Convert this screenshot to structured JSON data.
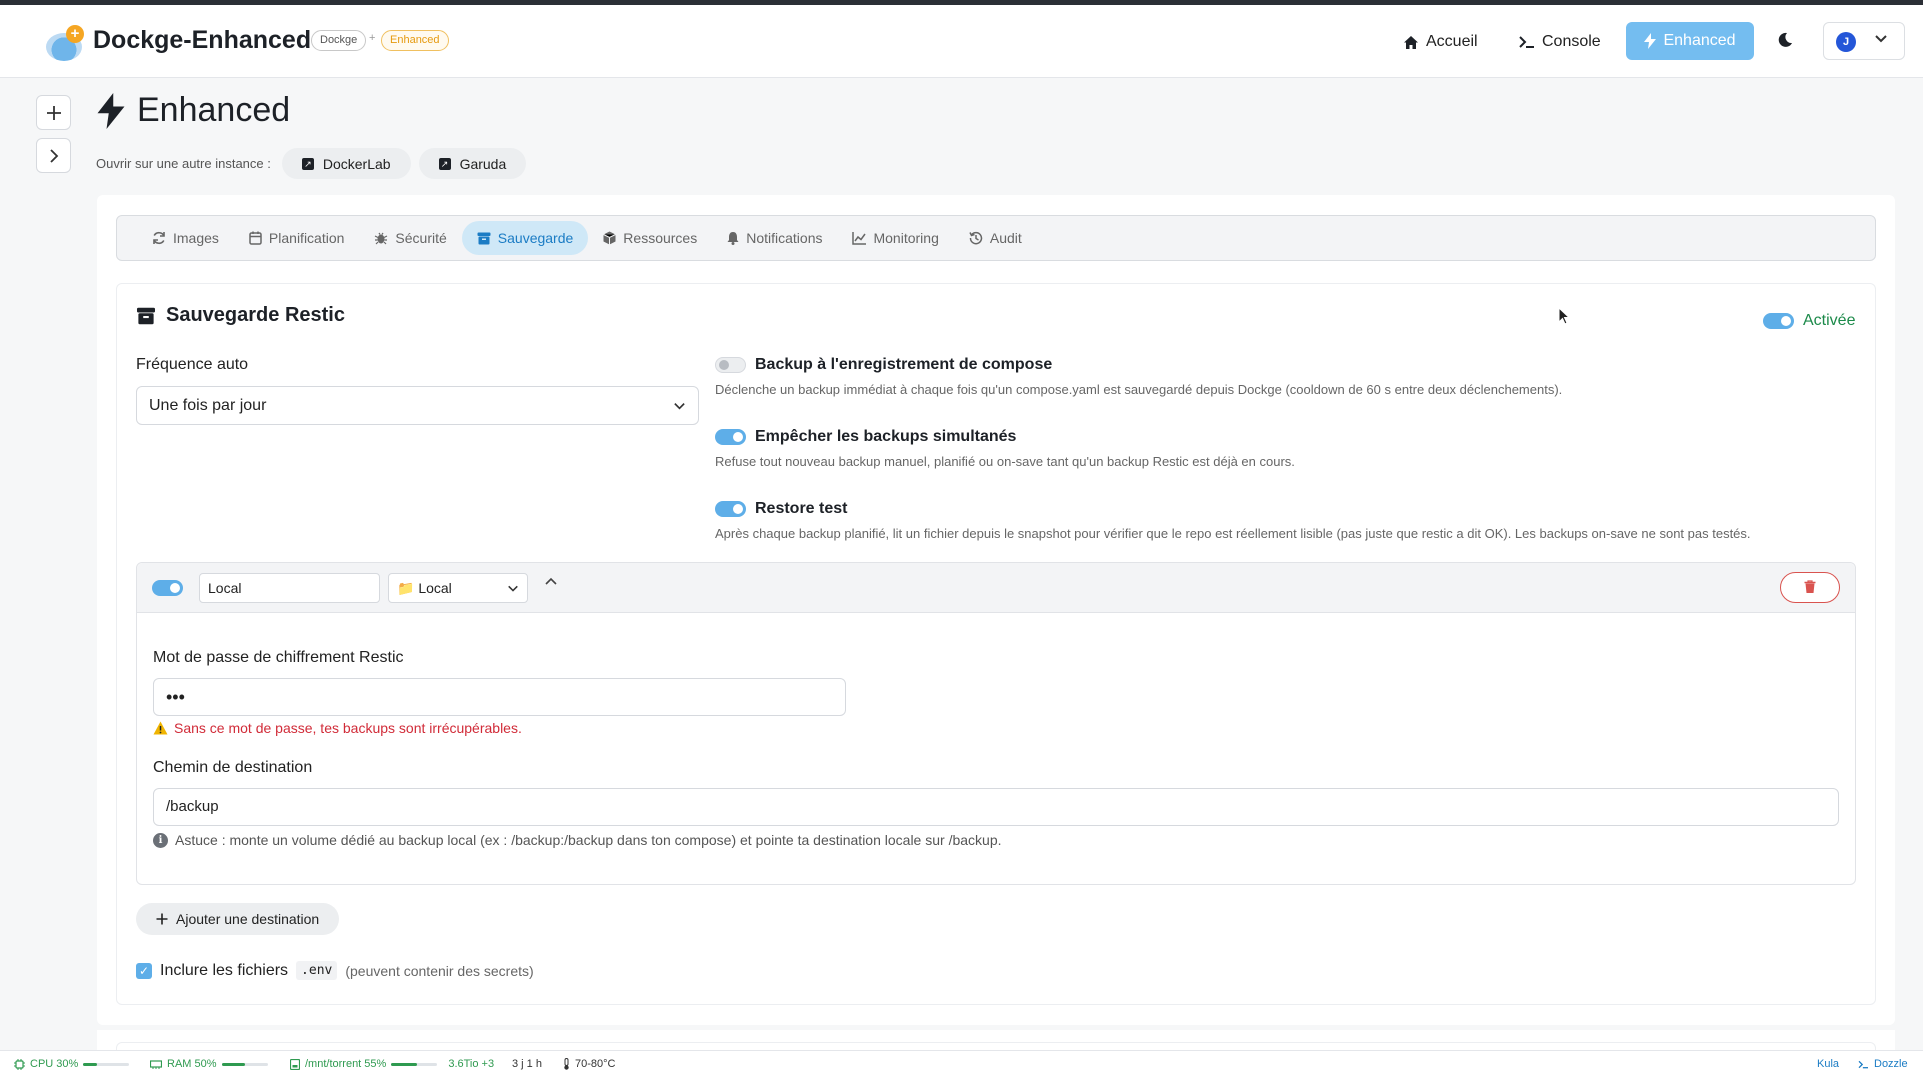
{
  "app": {
    "brand": "Dockge-Enhanced",
    "tag_dockge": "Dockge",
    "tag_plus": "+",
    "tag_enhanced": "Enhanced"
  },
  "nav": {
    "home": "Accueil",
    "console": "Console",
    "enhanced": "Enhanced",
    "user_initial": "J",
    "icons": [
      "home-icon",
      "terminal-icon",
      "bolt-icon",
      "moon-icon",
      "chevron-down-icon"
    ]
  },
  "page": {
    "title": "Enhanced",
    "instances_label": "Ouvrir sur une autre instance :",
    "instances": [
      "DockerLab",
      "Garuda"
    ]
  },
  "tabs": [
    "Images",
    "Planification",
    "Sécurité",
    "Sauvegarde",
    "Ressources",
    "Notifications",
    "Monitoring",
    "Audit"
  ],
  "active_tab": "Sauvegarde",
  "backup": {
    "title": "Sauvegarde Restic",
    "enabled_label": "Activée",
    "enabled": true,
    "freq_label": "Fréquence auto",
    "freq_value": "Une fois par jour",
    "options": [
      {
        "title": "Backup à l'enregistrement de compose",
        "desc": "Déclenche un backup immédiat à chaque fois qu'un compose.yaml est sauvegardé depuis Dockge (cooldown de 60 s entre deux déclenchements).",
        "on": false
      },
      {
        "title": "Empêcher les backups simultanés",
        "desc": "Refuse tout nouveau backup manuel, planifié ou on-save tant qu'un backup Restic est déjà en cours.",
        "on": true
      },
      {
        "title": "Restore test",
        "desc": "Après chaque backup planifié, lit un fichier depuis le snapshot pour vérifier que le repo est réellement lisible (pas juste que restic a dit OK). Les backups on-save ne sont pas testés.",
        "on": true
      }
    ],
    "destination": {
      "enabled": true,
      "name": "Local",
      "type": "📁 Local",
      "password_label": "Mot de passe de chiffrement Restic",
      "password_value": "•••",
      "password_warning": "Sans ce mot de passe, tes backups sont irrécupérables.",
      "path_label": "Chemin de destination",
      "path_value": "/backup",
      "hint": "Astuce : monte un volume dédié au backup local (ex : /backup:/backup dans ton compose) et pointe ta destination locale sur /backup."
    },
    "add_destination": "Ajouter une destination",
    "include_env_label": "Inclure les fichiers",
    "include_env_code": ".env",
    "include_env_note": "(peuvent contenir des secrets)",
    "include_env": true
  },
  "status": {
    "cpu": "CPU 30%",
    "cpu_level": 0.3,
    "ram": "RAM 50%",
    "ram_level": 0.5,
    "disk": "/mnt/torrent 55%",
    "disk_level": 0.55,
    "disk_extra": "3.6Tio +3",
    "uptime": "3 j 1 h",
    "temp": "70-80°C",
    "link1": "Kula",
    "link2": "Dozzle"
  },
  "colors": {
    "accent": "#74bdf0",
    "active_tab_bg": "#cfe8f7",
    "success": "#1c8a4a",
    "danger": "#d12b38"
  }
}
